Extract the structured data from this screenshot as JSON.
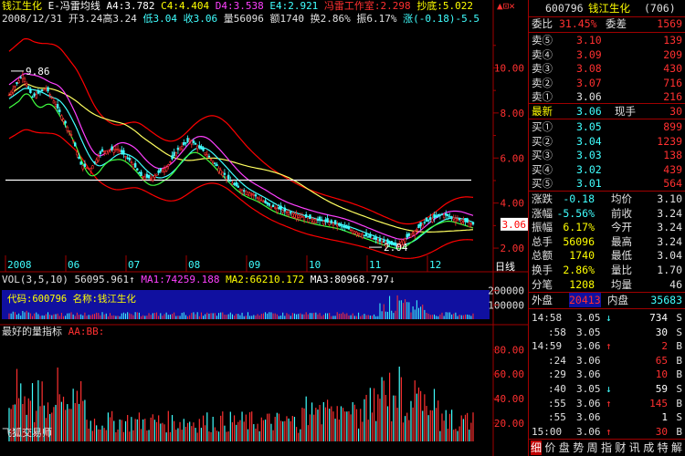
{
  "header": {
    "stock_name": "钱江生化",
    "indicator": "E-冯雷均线",
    "a4": "A4:3.782",
    "c4": "C4:4.404",
    "d4": "D4:3.538",
    "e4": "E4:2.921",
    "fl": "冯雷工作室:2.298",
    "cd": "抄底:5.022"
  },
  "info_line": {
    "date": "2008/12/31",
    "open": "开3.24",
    "high": "高3.24",
    "low": "低3.04",
    "close": "收3.06",
    "vol": "量56096",
    "amt": "额1740",
    "turnover": "换2.86%",
    "amp": "振6.17%",
    "change": "涨(-0.18)-5.5"
  },
  "vol_line": {
    "vol": "VOL(3,5,10)",
    "vol_val": "56095.961",
    "ma1": "MA1:74259.188",
    "ma2": "MA2:66210.172",
    "ma3": "MA3:80968.797"
  },
  "bottom_label": "最好的量指标",
  "bottom_ab": "AA:BB:",
  "watermark": "飞狐交易师",
  "vol_overlay": "代码:600796 名称:钱江生化",
  "period_label": "日线",
  "chart_data": [
    {
      "type": "candlestick",
      "y_ticks": [
        2.0,
        4.0,
        6.0,
        8.0,
        10.0
      ],
      "ylim": [
        0.95,
        11.8
      ],
      "x_ticks": [
        "2008",
        "06",
        "07",
        "08",
        "09",
        "10",
        "11",
        "12"
      ],
      "annotations": [
        {
          "text": "9.86",
          "value": 9.86
        },
        {
          "text": "2.04",
          "value": 2.04
        }
      ],
      "last_price": 3.06,
      "last_price_label": "3.06",
      "series_colors": {
        "upper": "#ff0000",
        "lower": "#ff0000",
        "yellow": "#ffff60",
        "white": "#ffffff",
        "magenta": "#ff40ff",
        "cyan": "#40ffff",
        "green": "#40ff40"
      },
      "segments": [
        {
          "x": 0.0,
          "c": 8.8,
          "h": 9.7
        },
        {
          "x": 0.06,
          "c": 9.7,
          "h": 10.5
        },
        {
          "x": 0.1,
          "c": 8.7,
          "h": 9.6
        },
        {
          "x": 0.16,
          "c": 9.1,
          "h": 10.1
        },
        {
          "x": 0.2,
          "c": 8.4,
          "h": 9.2
        },
        {
          "x": 0.27,
          "c": 7.0,
          "h": 7.6
        },
        {
          "x": 0.31,
          "c": 5.7,
          "h": 6.3
        },
        {
          "x": 0.35,
          "c": 5.5,
          "h": 6.0
        },
        {
          "x": 0.4,
          "c": 6.3,
          "h": 6.9
        },
        {
          "x": 0.47,
          "c": 6.4,
          "h": 7.0
        },
        {
          "x": 0.53,
          "c": 5.8,
          "h": 6.4
        },
        {
          "x": 0.57,
          "c": 5.2,
          "h": 5.6
        },
        {
          "x": 0.61,
          "c": 5.1,
          "h": 5.8
        },
        {
          "x": 0.68,
          "c": 5.6,
          "h": 6.5
        },
        {
          "x": 0.73,
          "c": 6.4,
          "h": 7.2
        },
        {
          "x": 0.78,
          "c": 6.8,
          "h": 7.6
        },
        {
          "x": 0.84,
          "c": 6.3,
          "h": 7.4
        },
        {
          "x": 0.9,
          "c": 5.6,
          "h": 6.6
        },
        {
          "x": 0.96,
          "c": 4.9,
          "h": 6.0
        },
        {
          "x": 1.0,
          "c": 4.6,
          "h": 5.5
        }
      ]
    },
    {
      "type": "bar",
      "title": "VOL(3,5,10)",
      "y_ticks": [
        100000,
        200000
      ],
      "y_tick_labels": [
        "100000",
        "200000"
      ],
      "ylim": [
        0,
        230000
      ]
    },
    {
      "type": "bar",
      "title": "最好的量指标",
      "y_ticks": [
        20,
        40,
        60,
        80
      ],
      "y_tick_labels": [
        "20.00",
        "40.00",
        "60.00",
        "80.00"
      ],
      "ylim": [
        5,
        90
      ]
    }
  ],
  "panel": {
    "code": "600796",
    "name": "钱江生化",
    "code_num": "(706)",
    "weibi_label": "委比",
    "weibi_val": "31.45%",
    "weicha_label": "委差",
    "weicha_val": "1569",
    "sells": [
      {
        "label": "卖⑤",
        "price": "3.10",
        "vol": "139"
      },
      {
        "label": "卖④",
        "price": "3.09",
        "vol": "209"
      },
      {
        "label": "卖③",
        "price": "3.08",
        "vol": "430"
      },
      {
        "label": "卖②",
        "price": "3.07",
        "vol": "716"
      },
      {
        "label": "卖①",
        "price": "3.06",
        "vol": "216"
      }
    ],
    "latest_label": "最新",
    "latest_price": "3.06",
    "xianshou_label": "现手",
    "xianshou_val": "30",
    "buys": [
      {
        "label": "买①",
        "price": "3.05",
        "vol": "899"
      },
      {
        "label": "买②",
        "price": "3.04",
        "vol": "1239"
      },
      {
        "label": "买③",
        "price": "3.03",
        "vol": "138"
      },
      {
        "label": "买④",
        "price": "3.02",
        "vol": "439"
      },
      {
        "label": "买⑤",
        "price": "3.01",
        "vol": "564"
      }
    ],
    "stats": [
      {
        "l1": "涨跌",
        "v1": "-0.18",
        "l2": "均价",
        "v2": "3.10"
      },
      {
        "l1": "涨幅",
        "v1": "-5.56%",
        "l2": "前收",
        "v2": "3.24"
      },
      {
        "l1": "振幅",
        "v1": "6.17%",
        "l2": "今开",
        "v2": "3.24"
      },
      {
        "l1": "总手",
        "v1": "56096",
        "l2": "最高",
        "v2": "3.24"
      },
      {
        "l1": "总额",
        "v1": "1740",
        "l2": "最低",
        "v2": "3.04"
      },
      {
        "l1": "换手",
        "v1": "2.86%",
        "l2": "量比",
        "v2": "1.70"
      },
      {
        "l1": "分笔",
        "v1": "1208",
        "l2": "均量",
        "v2": "46"
      }
    ],
    "waipan_label": "外盘",
    "waipan_val": "20413",
    "neipan_label": "内盘",
    "neipan_val": "35683",
    "ticks": [
      {
        "time": "14:58",
        "price": "3.05",
        "arrow": "↓",
        "vol": "734",
        "bs": "S"
      },
      {
        "time": ":58",
        "price": "3.05",
        "arrow": "",
        "vol": "30",
        "bs": "S"
      },
      {
        "time": "14:59",
        "price": "3.06",
        "arrow": "↑",
        "vol": "2",
        "bs": "B"
      },
      {
        "time": ":24",
        "price": "3.06",
        "arrow": "",
        "vol": "65",
        "bs": "B"
      },
      {
        "time": ":29",
        "price": "3.06",
        "arrow": "",
        "vol": "10",
        "bs": "B"
      },
      {
        "time": ":40",
        "price": "3.05",
        "arrow": "↓",
        "vol": "59",
        "bs": "S"
      },
      {
        "time": ":55",
        "price": "3.06",
        "arrow": "↑",
        "vol": "145",
        "bs": "B"
      },
      {
        "time": ":55",
        "price": "3.06",
        "arrow": "",
        "vol": "1",
        "bs": "S"
      },
      {
        "time": "15:00",
        "price": "3.06",
        "arrow": "↑",
        "vol": "30",
        "bs": "B"
      }
    ],
    "tabs": [
      "细",
      "价",
      "盘",
      "势",
      "周",
      "指",
      "财",
      "讯",
      "成",
      "特",
      "解"
    ]
  }
}
